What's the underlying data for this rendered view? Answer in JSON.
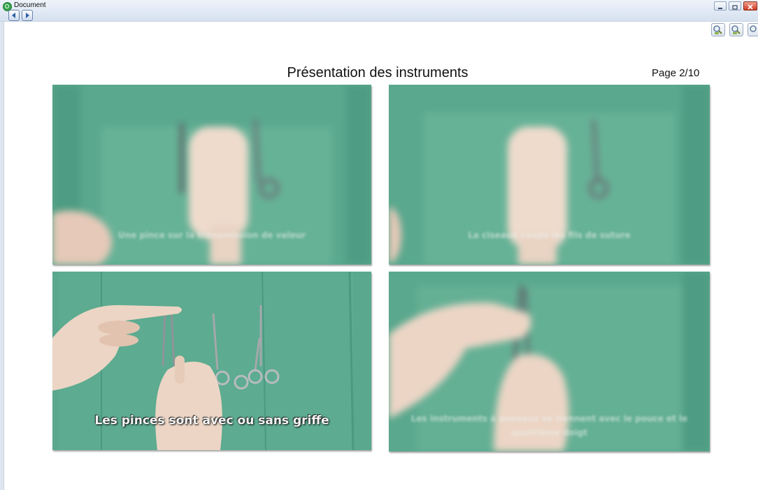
{
  "window": {
    "title": "Document",
    "icons": {
      "app": "qlik-app-icon",
      "back": "back-arrow-icon",
      "forward": "forward-arrow-icon",
      "minimize": "minimize-icon",
      "maximize": "maximize-icon",
      "close": "close-icon",
      "zoom_in": "zoom-in-icon",
      "zoom_out": "zoom-out-icon",
      "zoom_fit": "zoom-fit-icon"
    }
  },
  "document": {
    "title": "Présentation des instruments",
    "page_label": "Page 2/10",
    "frames": [
      {
        "caption": "Une pince sur la transmission de valeur"
      },
      {
        "caption": "La ciseaux coupe les fils de suture"
      },
      {
        "caption": "Les pinces sont avec ou sans griffe"
      },
      {
        "caption": "Les instruments à anneaux se tiennent avec le pouce et le quatrième doigt"
      }
    ]
  },
  "colors": {
    "drape": "#5aa88e",
    "drape_dark": "#4b9980",
    "glove": "#e9cdbb",
    "steel": "#a9adb0"
  }
}
